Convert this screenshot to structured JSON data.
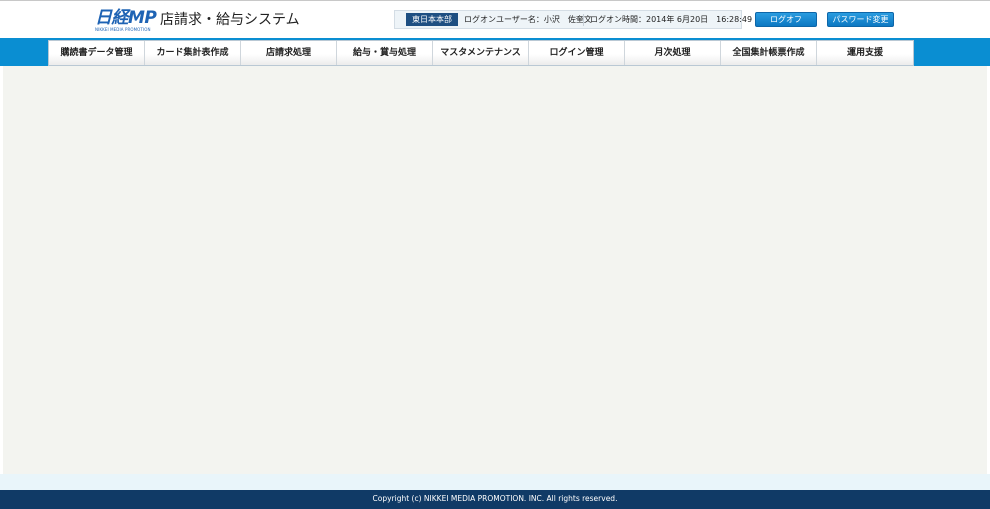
{
  "header": {
    "logo_main": "日経MP",
    "logo_sub": "NIKKEI MEDIA PROMOTION",
    "system_title": "店請求・給与システム",
    "branch": "東日本本部",
    "login_user": "ログオンユーザー名：小沢　佐奎文",
    "login_time": "ログオン時間：2014年 6月20日　16:28:49",
    "logoff_label": "ログオフ",
    "password_change_label": "パスワード変更"
  },
  "nav": {
    "items": [
      {
        "label": "購読書データ管理"
      },
      {
        "label": "カード集計表作成"
      },
      {
        "label": "店請求処理"
      },
      {
        "label": "給与・賞与処理"
      },
      {
        "label": "マスタメンテナンス"
      },
      {
        "label": "ログイン管理"
      },
      {
        "label": "月次処理"
      },
      {
        "label": "全国集計帳票作成"
      },
      {
        "label": "運用支援"
      }
    ]
  },
  "footer": {
    "copyright": "Copyright (c) NIKKEI MEDIA PROMOTION. INC. All rights reserved."
  },
  "colors": {
    "nav_band": "#0a8ed2",
    "footer": "#103a66",
    "brand_blue": "#1e63b4",
    "content_bg": "#f3f4f0"
  }
}
